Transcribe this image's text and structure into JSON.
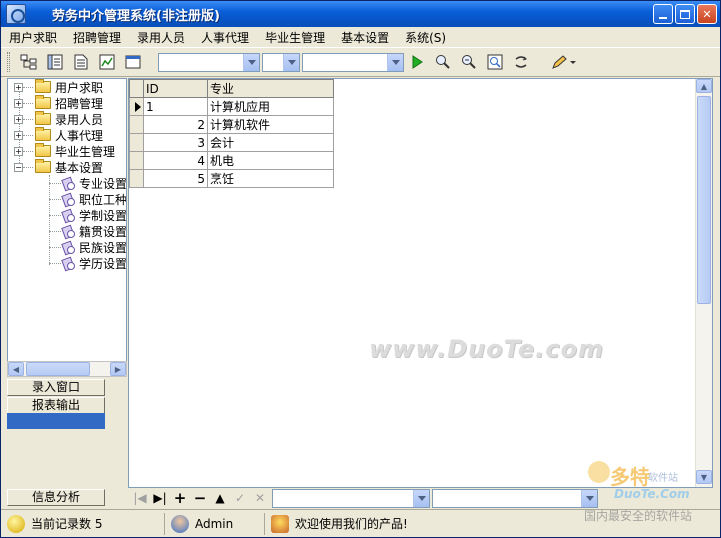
{
  "window": {
    "title": "劳务中介管理系统(非注册版)"
  },
  "menu": [
    "用户求职",
    "招聘管理",
    "录用人员",
    "人事代理",
    "毕业生管理",
    "基本设置",
    "系统(S)"
  ],
  "tree": {
    "groups": [
      "用户求职",
      "招聘管理",
      "录用人员",
      "人事代理",
      "毕业生管理",
      "基本设置"
    ],
    "children": [
      "专业设置",
      "职位工种",
      "学制设置",
      "籍贯设置",
      "民族设置",
      "学历设置"
    ]
  },
  "nav_buttons": {
    "entry": "录入窗口",
    "report": "报表输出",
    "info": "信息分析"
  },
  "grid": {
    "headers": [
      "ID",
      "专业"
    ],
    "rows": [
      {
        "id": "1",
        "name": "计算机应用"
      },
      {
        "id": "2",
        "name": "计算机软件"
      },
      {
        "id": "3",
        "name": "会计"
      },
      {
        "id": "4",
        "name": "机电"
      },
      {
        "id": "5",
        "name": "烹饪"
      }
    ]
  },
  "watermark": "www.DuoTe.com",
  "status": {
    "record_count": "当前记录数 5",
    "user": "Admin",
    "message": "欢迎使用我们的产品!"
  },
  "brand": {
    "name": "多特",
    "sub": "软件站",
    "url": "DuoTe.Com",
    "tagline": "国内最安全的软件站"
  }
}
